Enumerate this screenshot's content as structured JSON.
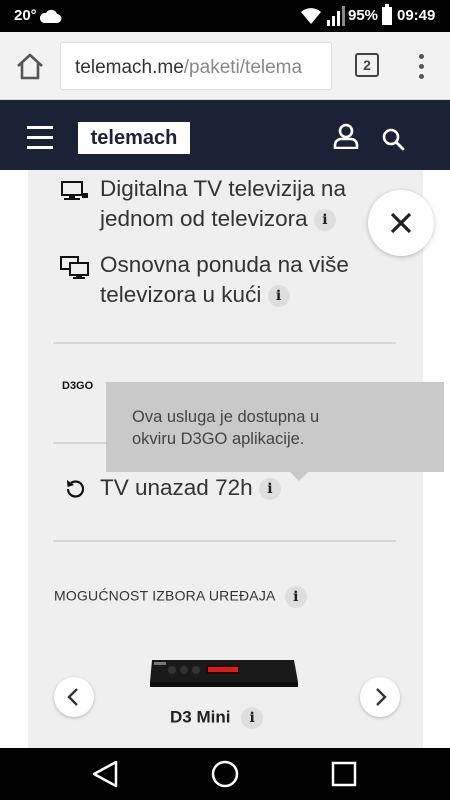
{
  "status_bar": {
    "temperature": "20°",
    "battery_percent": "95%",
    "time": "09:49",
    "icons": [
      "cloud-icon",
      "wifi-icon",
      "signal-icon",
      "battery-icon"
    ]
  },
  "browser": {
    "url_host": "telemach.me",
    "url_path": "/paketi/telema",
    "tab_count": "2"
  },
  "site_header": {
    "logo_text": "telemach"
  },
  "features": [
    {
      "icon": "tv-icon",
      "line1": "Digitalna TV televizija na",
      "line2": "jednom od televizora",
      "info": "i"
    },
    {
      "icon": "multi-tv-icon",
      "line1": "Osnovna ponuda na više",
      "line2": "televizora u kući",
      "info": "i"
    },
    {
      "icon": "d3go-logo",
      "logo_text": "D3GO"
    },
    {
      "icon": "replay-icon",
      "line1": "TV unazad 72h",
      "info": "i"
    }
  ],
  "tooltip": {
    "line1": "Ova usluga je dostupna u",
    "line2": "okviru D3GO aplikacije."
  },
  "device_section": {
    "title": "MOGUĆNOST IZBORA UREĐAJA",
    "info": "i",
    "device_name": "D3 Mini",
    "device_info": "i"
  },
  "colors": {
    "header_bg": "#1b2236",
    "panel_bg": "#efefef",
    "tooltip_bg": "#c9c9c9"
  }
}
